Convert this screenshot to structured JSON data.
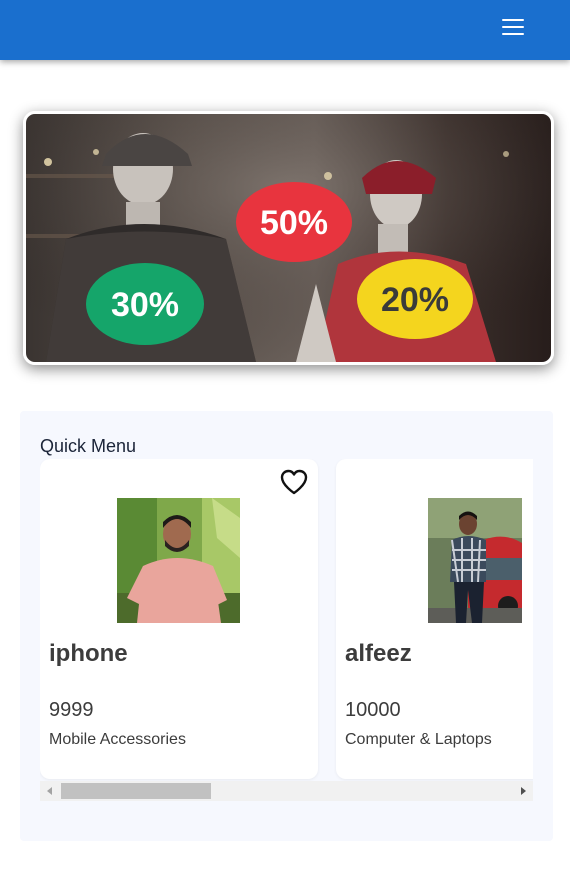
{
  "header": {
    "menu_icon": "hamburger-menu-icon",
    "color": "#1a6fce"
  },
  "banner": {
    "badges": [
      {
        "text": "50%",
        "color": "#e8343e"
      },
      {
        "text": "30%",
        "color": "#15a56a"
      },
      {
        "text": "20%",
        "color": "#f4d51e"
      }
    ]
  },
  "quick_menu": {
    "title": "Quick Menu",
    "items": [
      {
        "name": "iphone",
        "price": "9999",
        "category": "Mobile Accessories",
        "favorite_icon": "heart-outline-icon"
      },
      {
        "name": "alfeez",
        "price": "10000",
        "category": "Computer & Laptops"
      }
    ],
    "scroll_position": 0.0
  }
}
